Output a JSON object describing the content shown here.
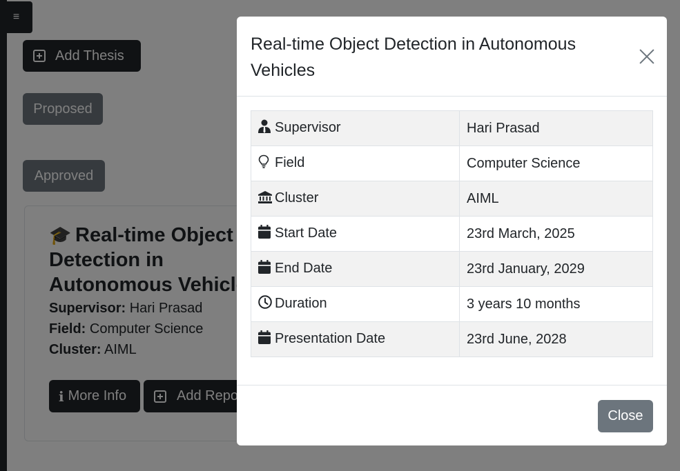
{
  "background": {
    "menu_icon": "hamburger-icon",
    "add_thesis_label": "Add Thesis",
    "proposed_label": "Proposed",
    "approved_label": "Approved",
    "card": {
      "title": "Real-time Object Detection in Autonomous Vehicles",
      "supervisor_label": "Supervisor:",
      "supervisor_value": "Hari Prasad",
      "field_label": "Field:",
      "field_value": "Computer Science",
      "cluster_label": "Cluster:",
      "cluster_value": "AIML",
      "more_info_label": "More Info",
      "add_report_label": "Add Report"
    }
  },
  "modal": {
    "title": "Real-time Object Detection in Autonomous Vehicles",
    "close_label": "Close",
    "rows": [
      {
        "icon": "supervisor-icon",
        "label": "Supervisor",
        "value": "Hari Prasad"
      },
      {
        "icon": "lightbulb-icon",
        "label": "Field",
        "value": "Computer Science"
      },
      {
        "icon": "bank-icon",
        "label": "Cluster",
        "value": "AIML"
      },
      {
        "icon": "calendar-icon",
        "label": "Start Date",
        "value": "23rd March, 2025"
      },
      {
        "icon": "calendar-icon",
        "label": "End Date",
        "value": "23rd January, 2029"
      },
      {
        "icon": "clock-icon",
        "label": "Duration",
        "value": "3 years 10 months"
      },
      {
        "icon": "calendar-icon",
        "label": "Presentation Date",
        "value": "23rd June, 2028"
      }
    ]
  },
  "colors": {
    "dark": "#212529",
    "secondary": "#6c757d",
    "striped_row": "#f2f2f2",
    "border": "#dee2e6"
  }
}
